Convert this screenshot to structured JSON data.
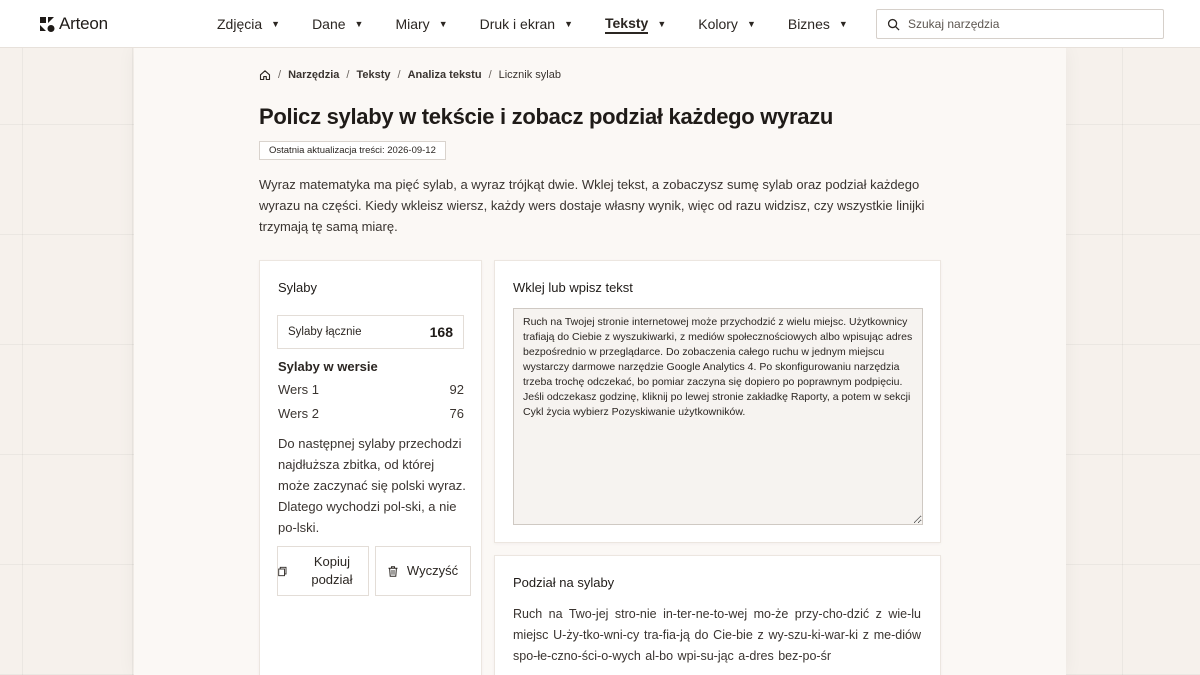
{
  "app": {
    "logo_text": "Arteon"
  },
  "nav": {
    "items": [
      {
        "label": "Zdjęcia"
      },
      {
        "label": "Dane"
      },
      {
        "label": "Miary"
      },
      {
        "label": "Druk i ekran"
      },
      {
        "label": "Teksty",
        "active": true
      },
      {
        "label": "Kolory"
      },
      {
        "label": "Biznes"
      }
    ]
  },
  "search": {
    "placeholder": "Szukaj narzędzia",
    "value": ""
  },
  "breadcrumb": {
    "items": [
      "Narzędzia",
      "Teksty",
      "Analiza tekstu"
    ],
    "current": "Licznik sylab"
  },
  "page": {
    "title": "Policz sylaby w tekście i zobacz podział każdego wyrazu",
    "updated": "Ostatnia aktualizacja treści: 2026-09-12",
    "intro": "Wyraz matematyka ma pięć sylab, a wyraz trójkąt dwie. Wklej tekst, a zobaczysz sumę sylab oraz podział każdego wyrazu na części. Kiedy wkleisz wiersz, każdy wers dostaje własny wynik, więc od razu widzisz, czy wszystkie linijki trzymają tę samą miarę."
  },
  "results": {
    "title": "Sylaby",
    "total_label": "Sylaby łącznie",
    "total_value": "168",
    "verses_heading": "Sylaby w wersie",
    "verses": [
      {
        "label": "Wers 1",
        "value": "92"
      },
      {
        "label": "Wers 2",
        "value": "76"
      }
    ],
    "note": "Do następnej sylaby przechodzi najdłuższa zbitka, od której może zaczynać się polski wyraz. Dlatego wychodzi pol-ski, a nie po-lski.",
    "copy_label": "Kopiuj podział",
    "clear_label": "Wyczyść"
  },
  "input": {
    "title": "Wklej lub wpisz tekst",
    "value": "Ruch na Twojej stronie internetowej może przychodzić z wielu miejsc. Użytkownicy trafiają do Ciebie z wyszukiwarki, z mediów społecznościowych albo wpisując adres bezpośrednio w przeglądarce. Do zobaczenia całego ruchu w jednym miejscu wystarczy darmowe narzędzie Google Analytics 4. Po skonfigurowaniu narzędzia trzeba trochę odczekać, bo pomiar zaczyna się dopiero po poprawnym podpięciu. Jeśli odczekasz godzinę, kliknij po lewej stronie zakładkę Raporty, a potem w sekcji Cykl życia wybierz Pozyskiwanie użytkowników."
  },
  "split": {
    "title": "Podział na sylaby",
    "text": "Ruch na Two-jej stro-nie in-ter-ne-to-wej mo-że przy-cho-dzić z wie-lu miejsc U-ży-tko-wni-cy tra-fia-ją do Cie-bie z wy-szu-ki-war-ki z me-diów spo-łe-czno-ści-o-wych al-bo wpi-su-jąc a-dres bez-po-śr"
  },
  "colors": {
    "text": "#2b2622",
    "page_bg": "#f6f1ec",
    "card_bg": "#ffffff"
  }
}
